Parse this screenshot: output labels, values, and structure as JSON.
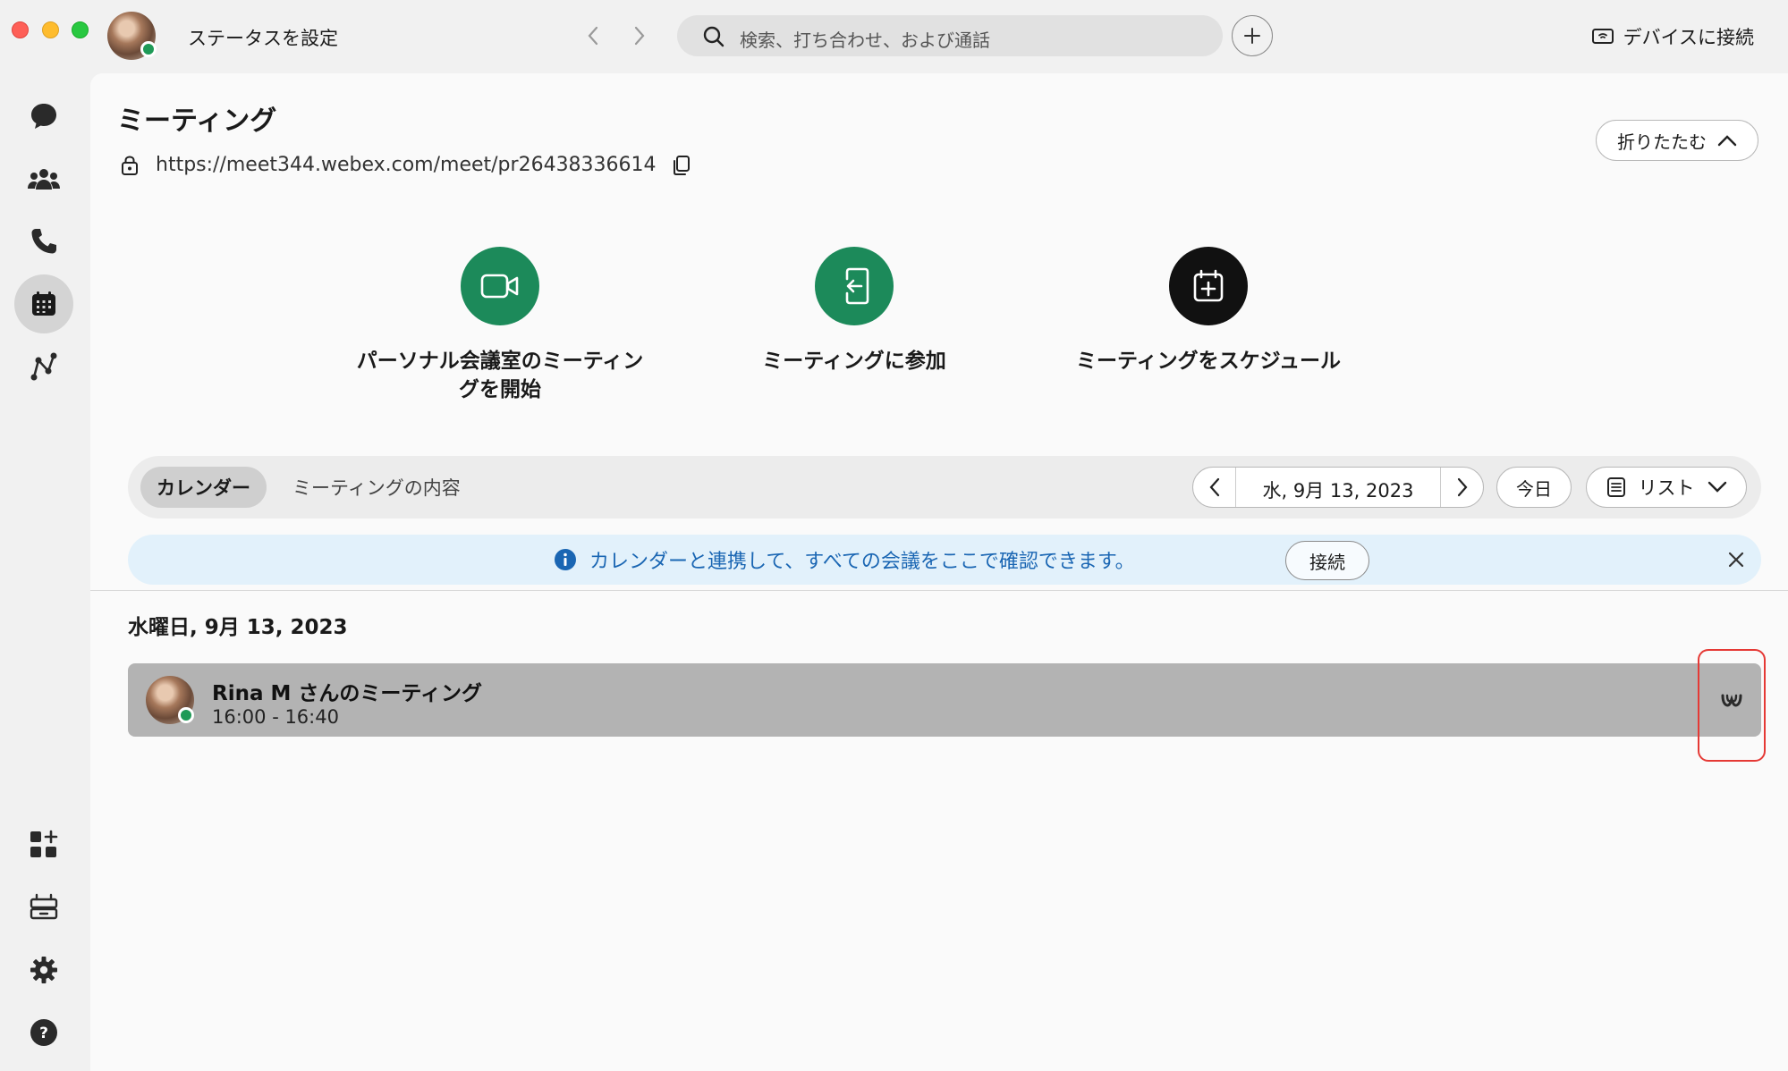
{
  "titlebar": {
    "status_label": "ステータスを設定",
    "search_placeholder": "検索、打ち合わせ、および通話",
    "device_connect_label": "デバイスに接続"
  },
  "sidebar": {
    "items": [
      {
        "name": "messaging",
        "icon": "chat-bubble-icon"
      },
      {
        "name": "teams",
        "icon": "people-icon"
      },
      {
        "name": "calling",
        "icon": "phone-icon"
      },
      {
        "name": "meetings",
        "icon": "calendar-icon",
        "active": true
      },
      {
        "name": "connections",
        "icon": "network-icon"
      }
    ],
    "bottom_items": [
      {
        "name": "apps",
        "icon": "add-apps-icon"
      },
      {
        "name": "workspace",
        "icon": "desk-icon"
      },
      {
        "name": "settings",
        "icon": "gear-icon"
      },
      {
        "name": "help",
        "icon": "help-icon"
      }
    ]
  },
  "main": {
    "title": "ミーティング",
    "url": "https://meet344.webex.com/meet/pr26438336614",
    "collapse_label": "折りたたむ",
    "actions": [
      {
        "label": "パーソナル会議室のミーティングを開始",
        "icon": "video-camera-icon",
        "color": "#1c8a5a"
      },
      {
        "label": "ミーティングに参加",
        "icon": "join-door-icon",
        "color": "#1c8a5a"
      },
      {
        "label": "ミーティングをスケジュール",
        "icon": "calendar-plus-icon",
        "color": "#111111"
      }
    ],
    "tabs": [
      {
        "label": "カレンダー",
        "active": true
      },
      {
        "label": "ミーティングの内容",
        "active": false
      }
    ],
    "date_nav": {
      "label": "水, 9月 13, 2023"
    },
    "today_label": "今日",
    "view_label": "リスト",
    "banner": {
      "text": "カレンダーと連携して、すべての会議をここで確認できます。",
      "button_label": "接続"
    },
    "date_heading": "水曜日, 9月 13, 2023",
    "meetings": [
      {
        "title": "Rina M さんのミーティング",
        "time": "16:00 - 16:40"
      }
    ]
  },
  "colors": {
    "accent_green": "#1c8a5a",
    "info_blue": "#1a66b3",
    "highlight_red": "#e53935",
    "presence_green": "#1f9a57"
  }
}
